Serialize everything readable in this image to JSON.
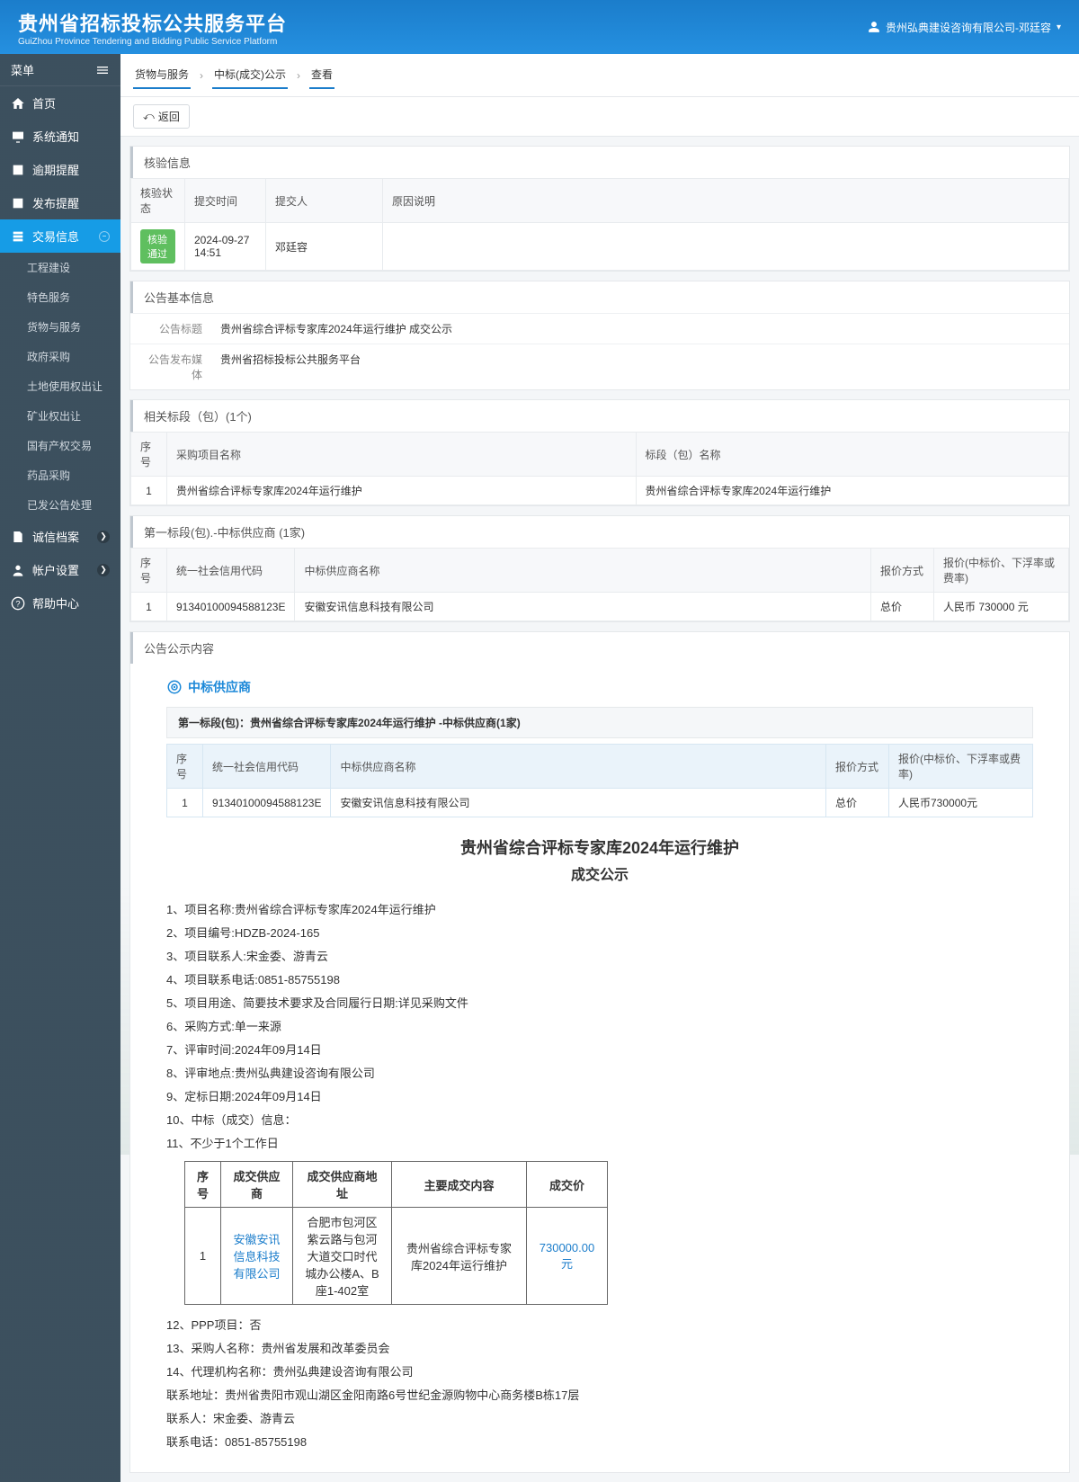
{
  "header": {
    "title": "贵州省招标投标公共服务平台",
    "subtitle": "GuiZhou Province Tendering and Bidding Public Service Platform",
    "user": "贵州弘典建设咨询有限公司-邓廷容"
  },
  "sidebar": {
    "menu_label": "菜单",
    "items": [
      {
        "label": "首页"
      },
      {
        "label": "系统通知"
      },
      {
        "label": "逾期提醒"
      },
      {
        "label": "发布提醒"
      },
      {
        "label": "交易信息",
        "active": true,
        "expand": "−"
      },
      {
        "label": "诚信档案",
        "dot": "❯"
      },
      {
        "label": "帐户设置",
        "dot": "❯"
      },
      {
        "label": "帮助中心"
      }
    ],
    "sub_items": [
      "工程建设",
      "特色服务",
      "货物与服务",
      "政府采购",
      "土地使用权出让",
      "矿业权出让",
      "国有产权交易",
      "药品采购",
      "已发公告处理"
    ]
  },
  "breadcrumb": {
    "a": "货物与服务",
    "b": "中标(成交)公示",
    "c": "查看"
  },
  "back_label": "返回",
  "verify": {
    "title": "核验信息",
    "headers": [
      "核验状态",
      "提交时间",
      "提交人",
      "原因说明"
    ],
    "row": {
      "status": "核验通过",
      "time": "2024-09-27 14:51",
      "person": "邓廷容",
      "reason": ""
    }
  },
  "basic": {
    "title": "公告基本信息",
    "label1": "公告标题",
    "value1": "贵州省综合评标专家库2024年运行维护 成交公示",
    "label2": "公告发布媒体",
    "value2": "贵州省招标投标公共服务平台"
  },
  "sections": {
    "title": "相关标段（包）(1个)",
    "headers": [
      "序号",
      "采购项目名称",
      "标段（包）名称"
    ],
    "row": {
      "no": "1",
      "proj": "贵州省综合评标专家库2024年运行维护",
      "pkg": "贵州省综合评标专家库2024年运行维护"
    }
  },
  "first_pkg": {
    "title": "第一标段(包).-中标供应商 (1家)",
    "headers": [
      "序号",
      "统一社会信用代码",
      "中标供应商名称",
      "报价方式",
      "报价(中标价、下浮率或费率)"
    ],
    "row": {
      "no": "1",
      "code": "91340100094588123E",
      "name": "安徽安讯信息科技有限公司",
      "method": "总价",
      "price": "人民币 730000 元"
    }
  },
  "content_title": "公告公示内容",
  "supplier_block": {
    "head": "中标供应商",
    "sub": "第一标段(包)：贵州省综合评标专家库2024年运行维护 -中标供应商(1家)",
    "headers": [
      "序号",
      "统一社会信用代码",
      "中标供应商名称",
      "报价方式",
      "报价(中标价、下浮率或费率)"
    ],
    "row": {
      "no": "1",
      "code": "91340100094588123E",
      "name": "安徽安讯信息科技有限公司",
      "method": "总价",
      "price": "人民币730000元"
    }
  },
  "doc": {
    "title": "贵州省综合评标专家库2024年运行维护",
    "subtitle": "成交公示",
    "lines": [
      "1、项目名称:贵州省综合评标专家库2024年运行维护",
      "2、项目编号:HDZB-2024-165",
      "3、项目联系人:宋金委、游青云",
      "4、项目联系电话:0851-85755198",
      "5、项目用途、简要技术要求及合同履行日期:详见采购文件",
      "6、采购方式:单一来源",
      "7、评审时间:2024年09月14日",
      "8、评审地点:贵州弘典建设咨询有限公司",
      "9、定标日期:2024年09月14日",
      "10、中标（成交）信息：",
      "11、不少于1个工作日"
    ],
    "deal_headers": [
      "序号",
      "成交供应商",
      "成交供应商地址",
      "主要成交内容",
      "成交价"
    ],
    "deal_row": {
      "no": "1",
      "supplier": "安徽安讯信息科技有限公司",
      "addr": "合肥市包河区紫云路与包河大道交口时代城办公楼A、B座1-402室",
      "content": "贵州省综合评标专家库2024年运行维护",
      "price": "730000.00元"
    },
    "lines2": [
      "12、PPP项目：否",
      "13、采购人名称：贵州省发展和改革委员会",
      "14、代理机构名称：贵州弘典建设咨询有限公司",
      "联系地址：贵州省贵阳市观山湖区金阳南路6号世纪金源购物中心商务楼B栋17层",
      "联系人：宋金委、游青云",
      "联系电话：0851-85755198"
    ]
  }
}
